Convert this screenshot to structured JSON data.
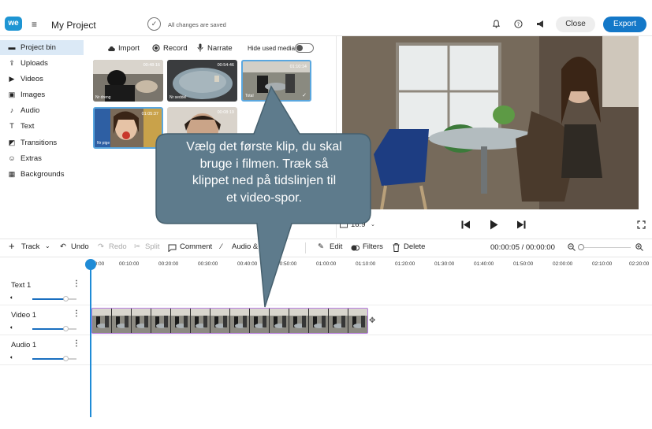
{
  "header": {
    "logo": "we",
    "menu_icon": "hamburger-icon",
    "project_title": "My Project",
    "save_status": "All changes are saved",
    "close_label": "Close",
    "export_label": "Export",
    "colors": {
      "export_bg": "#1478c8",
      "accent": "#1f8bd6"
    }
  },
  "sidebar": {
    "items": [
      {
        "label": "Project bin",
        "icon": "project-bin-icon"
      },
      {
        "label": "Uploads",
        "icon": "upload-icon"
      },
      {
        "label": "Videos",
        "icon": "video-icon"
      },
      {
        "label": "Images",
        "icon": "image-icon"
      },
      {
        "label": "Audio",
        "icon": "music-note-icon"
      },
      {
        "label": "Text",
        "icon": "text-icon"
      },
      {
        "label": "Transitions",
        "icon": "transitions-icon"
      },
      {
        "label": "Extras",
        "icon": "extras-icon"
      },
      {
        "label": "Backgrounds",
        "icon": "backgrounds-icon"
      }
    ],
    "active_index": 0
  },
  "media_toolbar": {
    "import_label": "Import",
    "record_label": "Record",
    "narrate_label": "Narrate",
    "hide_used_label": "Hide used media",
    "hide_used_on": false
  },
  "media": [
    {
      "name": "Nr dreng",
      "duration": "00:48:16"
    },
    {
      "name": "Nr seddel",
      "duration": "00:54:46"
    },
    {
      "name": "Total",
      "duration": "01:10:14",
      "selected": true
    },
    {
      "name": "Nr pige",
      "duration": "01:05:37"
    },
    {
      "name": "",
      "duration": "00:08:19"
    }
  ],
  "player": {
    "aspect_label": "16:9"
  },
  "edit_toolbar": {
    "track_label": "Track",
    "undo_label": "Undo",
    "redo_label": "Redo",
    "split_label": "Split",
    "comment_label": "Comment",
    "audio_opacity_label": "Audio & Op",
    "edit_label": "Edit",
    "filters_label": "Filters",
    "delete_label": "Delete",
    "time_display": "00:00:05 / 00:00:00"
  },
  "ruler": {
    "ticks": [
      "00:00",
      "00:10:00",
      "00:20:00",
      "00:30:00",
      "00:40:00",
      "00:50:00",
      "01:00:00",
      "01:10:00",
      "01:20:00",
      "01:30:00",
      "01:40:00",
      "01:50:00",
      "02:00:00",
      "02:10:00",
      "02:20:00"
    ]
  },
  "tracks": [
    {
      "name": "Text 1",
      "volume_pct": 75
    },
    {
      "name": "Video 1",
      "volume_pct": 75
    },
    {
      "name": "Audio 1",
      "volume_pct": 75
    }
  ],
  "callout": {
    "lines": [
      "Vælg det første klip, du skal",
      "bruge i filmen. Træk så",
      "klippet ned på tidslinjen til",
      "et video-spor."
    ]
  }
}
